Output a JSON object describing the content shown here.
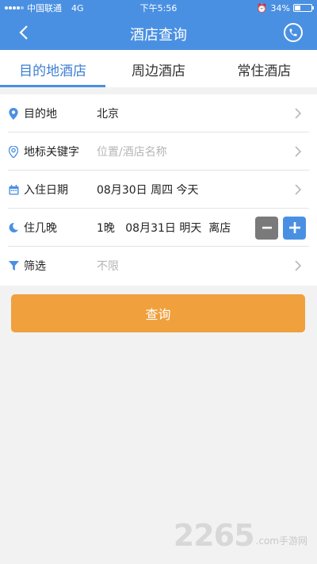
{
  "statusbar": {
    "carrier": "中国联通",
    "network": "4G",
    "time": "下午5:56",
    "battery": "34%",
    "battery_level": 0.34
  },
  "navbar": {
    "title": "酒店查询",
    "back_icon": "chevron-left-icon",
    "phone_icon": "phone-icon"
  },
  "tabs": [
    {
      "label": "目的地酒店",
      "active": true
    },
    {
      "label": "周边酒店",
      "active": false
    },
    {
      "label": "常住酒店",
      "active": false
    }
  ],
  "form": {
    "destination": {
      "label": "目的地",
      "value": "北京"
    },
    "keyword": {
      "label": "地标关键字",
      "placeholder": "位置/酒店名称"
    },
    "checkin": {
      "label": "入住日期",
      "value": "08月30日 周四 今天"
    },
    "nights": {
      "label": "住几晚",
      "value": "1晚   08月31日 明天  离店"
    },
    "filter": {
      "label": "筛选",
      "value": "不限"
    }
  },
  "query_button": {
    "label": "查询"
  },
  "watermark": {
    "number": "2265",
    "text": ".com手游网"
  },
  "colors": {
    "primary": "#4a90e2",
    "accent": "#f0a03c"
  }
}
